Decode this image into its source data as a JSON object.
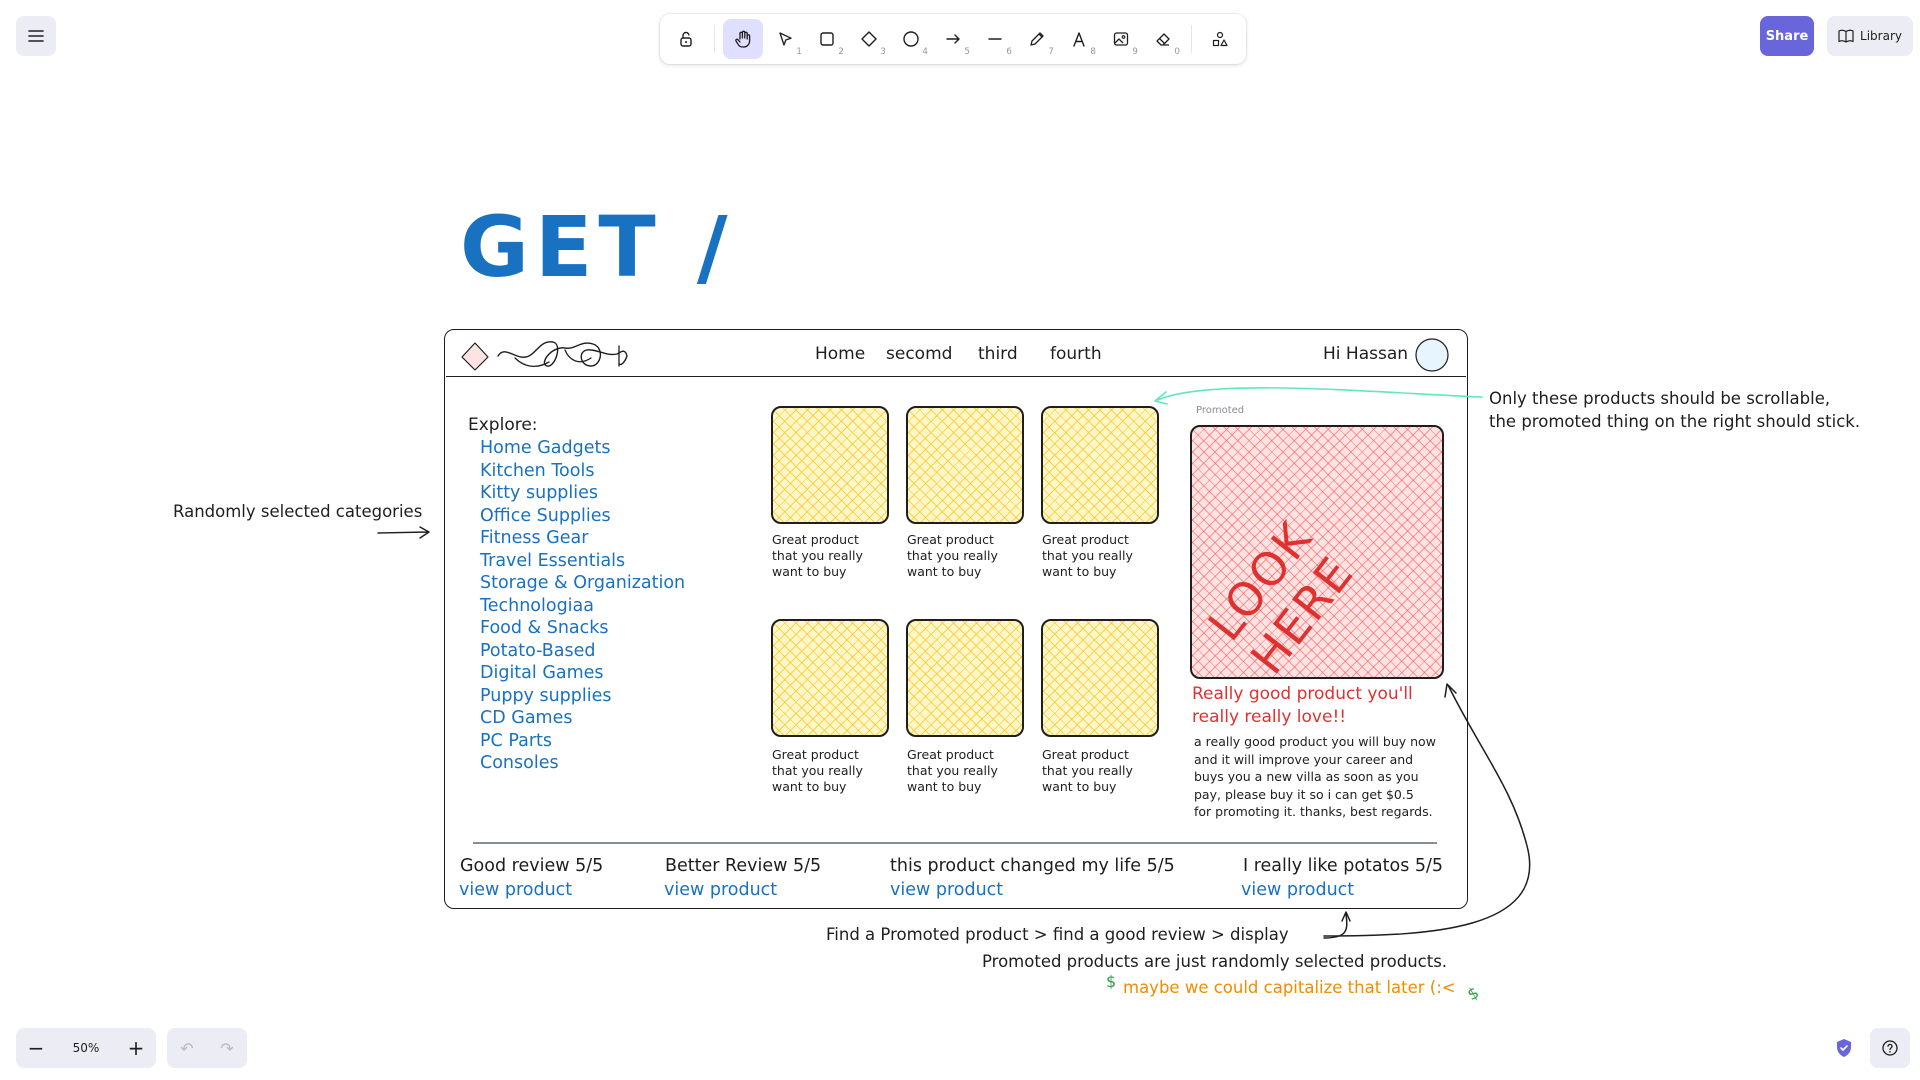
{
  "ui": {
    "toolbar_keys": [
      "1",
      "2",
      "3",
      "4",
      "5",
      "6",
      "7",
      "8",
      "9",
      "0"
    ],
    "share_label": "Share",
    "library_label": "Library",
    "zoom_value": "50%",
    "zoom_out_label": "−",
    "zoom_in_label": "+",
    "undo_label": "↶",
    "redo_label": "↷"
  },
  "canvas": {
    "title": "GET /",
    "mockup": {
      "nav": [
        "Home",
        "secomd",
        "third",
        "fourth"
      ],
      "greeting": "Hi Hassan",
      "explore_heading": "Explore:",
      "categories": [
        "Home Gadgets",
        "Kitchen Tools",
        "Kitty supplies",
        "Office Supplies",
        "Fitness Gear",
        "Travel Essentials",
        "Storage & Organization",
        "Technologiaa",
        "Food & Snacks",
        "Potato-Based",
        "Digital Games",
        "Puppy supplies",
        "CD Games",
        "PC Parts",
        "Consoles"
      ],
      "product_caption": [
        "Great product",
        "that you really",
        "want to buy"
      ],
      "promoted_label": "Promoted",
      "promo_image_text": "LOOK HERE",
      "promo_title_1": "Really good product you'll",
      "promo_title_2": "really really love!!",
      "promo_desc": [
        "a really good product you will buy now",
        "and it will improve your career and",
        "buys you a new villa as soon as you",
        "pay, please buy it so i can get $0.5",
        "for promoting it. thanks, best regards."
      ],
      "reviews": [
        {
          "title": "Good review 5/5",
          "link": "view product"
        },
        {
          "title": "Better Review 5/5",
          "link": "view product"
        },
        {
          "title": "this product changed my life 5/5",
          "link": "view product"
        },
        {
          "title": "I really like potatos 5/5",
          "link": "view product"
        }
      ]
    },
    "annotations": {
      "categories_note": "Randomly selected categories",
      "scroll_note_1": "Only these products should be scrollable,",
      "scroll_note_2": "the promoted thing on the right should stick.",
      "flow_note": "Find a Promoted product > find a good review > display",
      "random_note": "Promoted products are just randomly selected products.",
      "capitalize_note": "maybe we could capitalize that later (:<",
      "dollar": "$"
    }
  },
  "colors": {
    "accent": "#6965db",
    "blue_text": "#1971c2",
    "red_text": "#e03131",
    "orange_text": "#f08c00",
    "green_text": "#2f9e44",
    "arrow_teal": "#63e6be"
  }
}
